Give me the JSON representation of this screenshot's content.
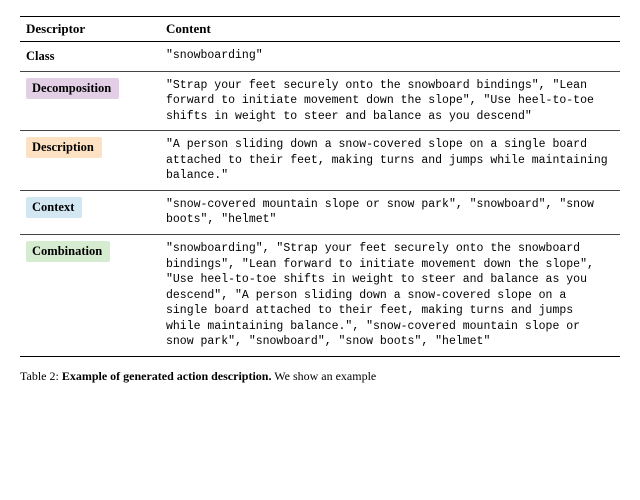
{
  "header": {
    "descriptor": "Descriptor",
    "content": "Content"
  },
  "rows": {
    "class": {
      "label": "Class",
      "content": "\"snowboarding\""
    },
    "decomposition": {
      "label": "Decomposition",
      "content": "\"Strap your feet securely onto the snowboard bindings\", \"Lean forward to initiate movement down the slope\", \"Use heel-to-toe shifts in weight to steer and balance as you descend\""
    },
    "description": {
      "label": "Description",
      "content": "\"A person sliding down a snow-covered slope on a single board attached to their feet, making turns and jumps while maintaining balance.\""
    },
    "context": {
      "label": "Context",
      "content": "\"snow-covered mountain slope or snow park\", \"snowboard\", \"snow boots\", \"helmet\""
    },
    "combination": {
      "label": "Combination",
      "content": "\"snowboarding\", \"Strap your feet securely onto the snowboard bindings\", \"Lean forward to initiate movement down the slope\", \"Use heel-to-toe shifts in weight to steer and balance as you descend\", \"A person sliding down a snow-covered slope on a single board attached to their feet, making turns and jumps while maintaining balance.\", \"snow-covered mountain slope or snow park\", \"snowboard\", \"snow boots\", \"helmet\""
    }
  },
  "caption": {
    "label": "Table 2:",
    "title": "Example of generated action description.",
    "tail": " We show an example"
  }
}
